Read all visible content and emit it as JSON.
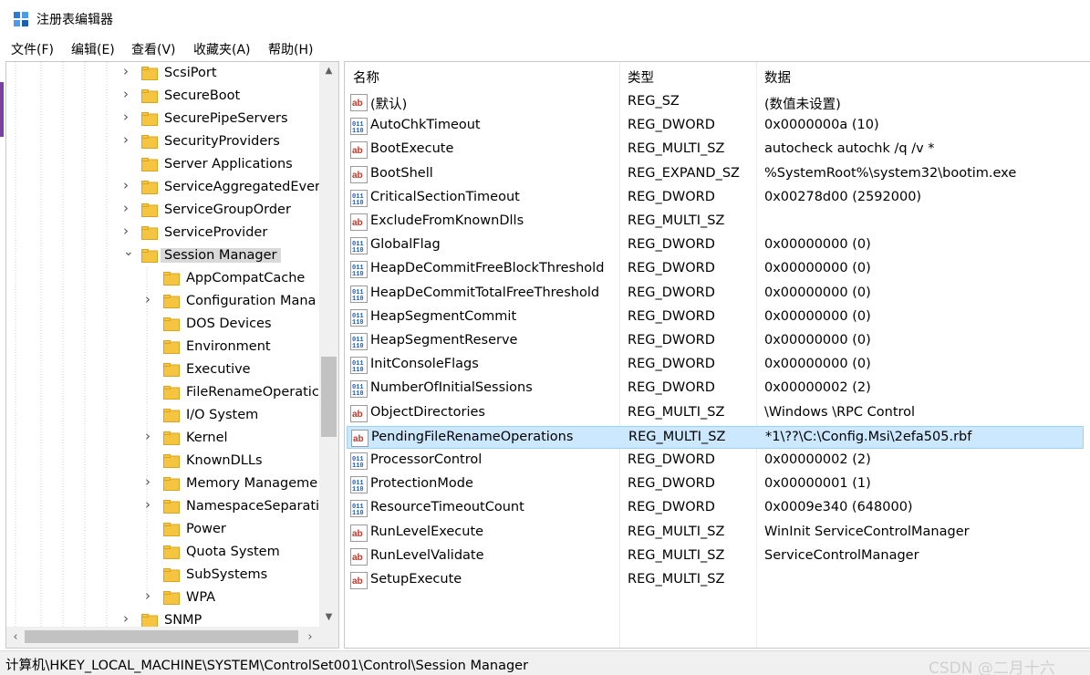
{
  "window": {
    "title": "注册表编辑器"
  },
  "menu": [
    "文件(F)",
    "编辑(E)",
    "查看(V)",
    "收藏夹(A)",
    "帮助(H)"
  ],
  "tree": [
    {
      "label": "ScsiPort",
      "level": 0,
      "expander": "collapsed"
    },
    {
      "label": "SecureBoot",
      "level": 0,
      "expander": "collapsed"
    },
    {
      "label": "SecurePipeServers",
      "level": 0,
      "expander": "collapsed"
    },
    {
      "label": "SecurityProviders",
      "level": 0,
      "expander": "collapsed"
    },
    {
      "label": "Server Applications",
      "level": 0,
      "expander": "none"
    },
    {
      "label": "ServiceAggregatedEver",
      "level": 0,
      "expander": "collapsed"
    },
    {
      "label": "ServiceGroupOrder",
      "level": 0,
      "expander": "collapsed"
    },
    {
      "label": "ServiceProvider",
      "level": 0,
      "expander": "collapsed"
    },
    {
      "label": "Session Manager",
      "level": 0,
      "expander": "expanded",
      "selected": true
    },
    {
      "label": "AppCompatCache",
      "level": 1,
      "expander": "none"
    },
    {
      "label": "Configuration Mana",
      "level": 1,
      "expander": "collapsed"
    },
    {
      "label": "DOS Devices",
      "level": 1,
      "expander": "none"
    },
    {
      "label": "Environment",
      "level": 1,
      "expander": "none"
    },
    {
      "label": "Executive",
      "level": 1,
      "expander": "none"
    },
    {
      "label": "FileRenameOperatic",
      "level": 1,
      "expander": "none"
    },
    {
      "label": "I/O System",
      "level": 1,
      "expander": "none"
    },
    {
      "label": "Kernel",
      "level": 1,
      "expander": "collapsed"
    },
    {
      "label": "KnownDLLs",
      "level": 1,
      "expander": "none"
    },
    {
      "label": "Memory Manageme",
      "level": 1,
      "expander": "collapsed"
    },
    {
      "label": "NamespaceSeparati",
      "level": 1,
      "expander": "collapsed"
    },
    {
      "label": "Power",
      "level": 1,
      "expander": "none"
    },
    {
      "label": "Quota System",
      "level": 1,
      "expander": "none"
    },
    {
      "label": "SubSystems",
      "level": 1,
      "expander": "none"
    },
    {
      "label": "WPA",
      "level": 1,
      "expander": "collapsed"
    },
    {
      "label": "SNMP",
      "level": 0,
      "expander": "collapsed"
    }
  ],
  "columns": {
    "name": "名称",
    "type": "类型",
    "data": "数据"
  },
  "values": [
    {
      "name": "(默认)",
      "type": "REG_SZ",
      "data": "(数值未设置)",
      "icon": "string-value-icon"
    },
    {
      "name": "AutoChkTimeout",
      "type": "REG_DWORD",
      "data": "0x0000000a (10)",
      "icon": "binary-value-icon"
    },
    {
      "name": "BootExecute",
      "type": "REG_MULTI_SZ",
      "data": "autocheck autochk /q /v *",
      "icon": "string-value-icon"
    },
    {
      "name": "BootShell",
      "type": "REG_EXPAND_SZ",
      "data": "%SystemRoot%\\system32\\bootim.exe",
      "icon": "string-value-icon"
    },
    {
      "name": "CriticalSectionTimeout",
      "type": "REG_DWORD",
      "data": "0x00278d00 (2592000)",
      "icon": "binary-value-icon"
    },
    {
      "name": "ExcludeFromKnownDlls",
      "type": "REG_MULTI_SZ",
      "data": "",
      "icon": "string-value-icon"
    },
    {
      "name": "GlobalFlag",
      "type": "REG_DWORD",
      "data": "0x00000000 (0)",
      "icon": "binary-value-icon"
    },
    {
      "name": "HeapDeCommitFreeBlockThreshold",
      "type": "REG_DWORD",
      "data": "0x00000000 (0)",
      "icon": "binary-value-icon"
    },
    {
      "name": "HeapDeCommitTotalFreeThreshold",
      "type": "REG_DWORD",
      "data": "0x00000000 (0)",
      "icon": "binary-value-icon"
    },
    {
      "name": "HeapSegmentCommit",
      "type": "REG_DWORD",
      "data": "0x00000000 (0)",
      "icon": "binary-value-icon"
    },
    {
      "name": "HeapSegmentReserve",
      "type": "REG_DWORD",
      "data": "0x00000000 (0)",
      "icon": "binary-value-icon"
    },
    {
      "name": "InitConsoleFlags",
      "type": "REG_DWORD",
      "data": "0x00000000 (0)",
      "icon": "binary-value-icon"
    },
    {
      "name": "NumberOfInitialSessions",
      "type": "REG_DWORD",
      "data": "0x00000002 (2)",
      "icon": "binary-value-icon"
    },
    {
      "name": "ObjectDirectories",
      "type": "REG_MULTI_SZ",
      "data": "\\Windows \\RPC Control",
      "icon": "string-value-icon"
    },
    {
      "name": "PendingFileRenameOperations",
      "type": "REG_MULTI_SZ",
      "data": "*1\\??\\C:\\Config.Msi\\2efa505.rbf",
      "icon": "string-value-icon",
      "selected": true
    },
    {
      "name": "ProcessorControl",
      "type": "REG_DWORD",
      "data": "0x00000002 (2)",
      "icon": "binary-value-icon"
    },
    {
      "name": "ProtectionMode",
      "type": "REG_DWORD",
      "data": "0x00000001 (1)",
      "icon": "binary-value-icon"
    },
    {
      "name": "ResourceTimeoutCount",
      "type": "REG_DWORD",
      "data": "0x0009e340 (648000)",
      "icon": "binary-value-icon"
    },
    {
      "name": "RunLevelExecute",
      "type": "REG_MULTI_SZ",
      "data": "WinInit ServiceControlManager",
      "icon": "string-value-icon"
    },
    {
      "name": "RunLevelValidate",
      "type": "REG_MULTI_SZ",
      "data": "ServiceControlManager",
      "icon": "string-value-icon"
    },
    {
      "name": "SetupExecute",
      "type": "REG_MULTI_SZ",
      "data": "",
      "icon": "string-value-icon"
    }
  ],
  "status": {
    "path": "计算机\\HKEY_LOCAL_MACHINE\\SYSTEM\\ControlSet001\\Control\\Session Manager"
  },
  "watermark": "CSDN @二月十六",
  "colors": {
    "selection": "#cce8ff",
    "selection_border": "#99d1ff",
    "tree_selection": "#d9d9d9",
    "folder": "#f5c542",
    "string_icon": "#c0392b",
    "binary_icon": "#1f5fbf"
  }
}
